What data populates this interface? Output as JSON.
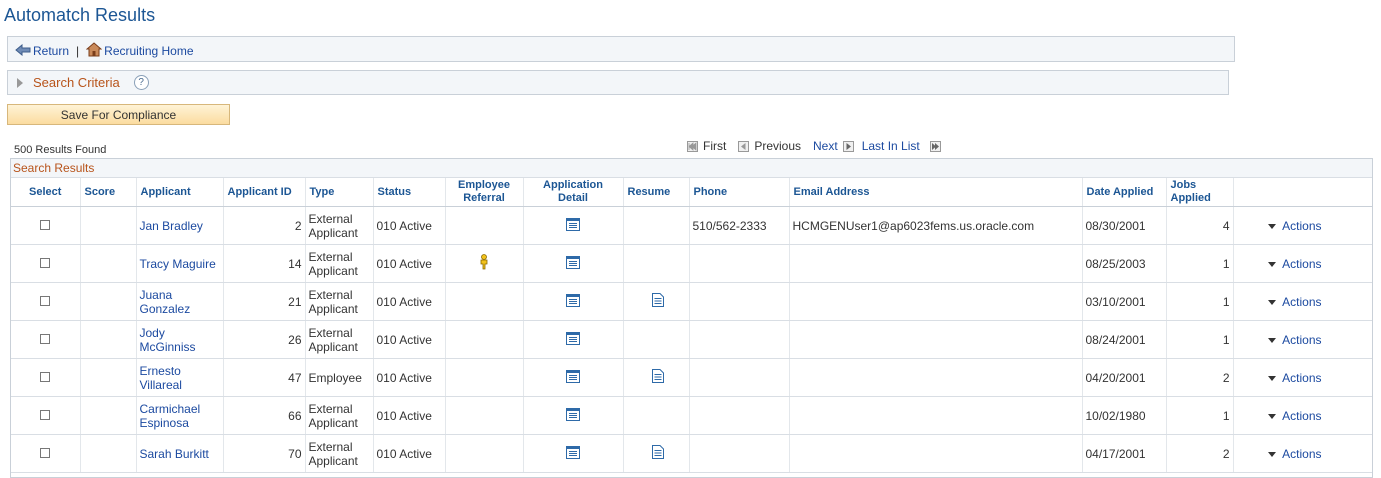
{
  "page": {
    "title": "Automatch Results"
  },
  "nav": {
    "return_label": "Return",
    "separator": "|",
    "home_label": "Recruiting Home"
  },
  "criteria": {
    "label": "Search Criteria",
    "help": "?"
  },
  "toolbar": {
    "save_label": "Save For Compliance"
  },
  "results": {
    "count_label": "500 Results Found"
  },
  "pager": {
    "first": "First",
    "previous": "Previous",
    "next": "Next",
    "last": "Last In List"
  },
  "grid": {
    "title": "Search Results",
    "columns": [
      "Select",
      "Score",
      "Applicant",
      "Applicant ID",
      "Type",
      "Status",
      "Employee Referral",
      "Application Detail",
      "Resume",
      "Phone",
      "Email Address",
      "Date Applied",
      "Jobs Applied",
      ""
    ],
    "actions_label": "Actions",
    "rows": [
      {
        "applicant": "Jan Bradley",
        "id": "2",
        "type": "External Applicant",
        "status": "010 Active",
        "referral": false,
        "resume": false,
        "phone": "510/562-2333",
        "email": "HCMGENUser1@ap6023fems.us.oracle.com",
        "date": "08/30/2001",
        "jobs": "4"
      },
      {
        "applicant": "Tracy Maguire",
        "id": "14",
        "type": "External Applicant",
        "status": "010 Active",
        "referral": true,
        "resume": false,
        "phone": "",
        "email": "",
        "date": "08/25/2003",
        "jobs": "1"
      },
      {
        "applicant": "Juana Gonzalez",
        "id": "21",
        "type": "External Applicant",
        "status": "010 Active",
        "referral": false,
        "resume": true,
        "phone": "",
        "email": "",
        "date": "03/10/2001",
        "jobs": "1"
      },
      {
        "applicant": "Jody McGinniss",
        "id": "26",
        "type": "External Applicant",
        "status": "010 Active",
        "referral": false,
        "resume": false,
        "phone": "",
        "email": "",
        "date": "08/24/2001",
        "jobs": "1"
      },
      {
        "applicant": "Ernesto Villareal",
        "id": "47",
        "type": "Employee",
        "status": "010 Active",
        "referral": false,
        "resume": true,
        "phone": "",
        "email": "",
        "date": "04/20/2001",
        "jobs": "2"
      },
      {
        "applicant": "Carmichael Espinosa",
        "id": "66",
        "type": "External Applicant",
        "status": "010 Active",
        "referral": false,
        "resume": false,
        "phone": "",
        "email": "",
        "date": "10/02/1980",
        "jobs": "1"
      },
      {
        "applicant": "Sarah Burkitt",
        "id": "70",
        "type": "External Applicant",
        "status": "010 Active",
        "referral": false,
        "resume": true,
        "phone": "",
        "email": "",
        "date": "04/17/2001",
        "jobs": "2"
      }
    ]
  },
  "colors": {
    "title": "#1c5694",
    "link": "#1c4aa0",
    "section_label": "#b8541b",
    "header_bg": "#f3f6f9",
    "button_bg": "#fbdca0"
  }
}
